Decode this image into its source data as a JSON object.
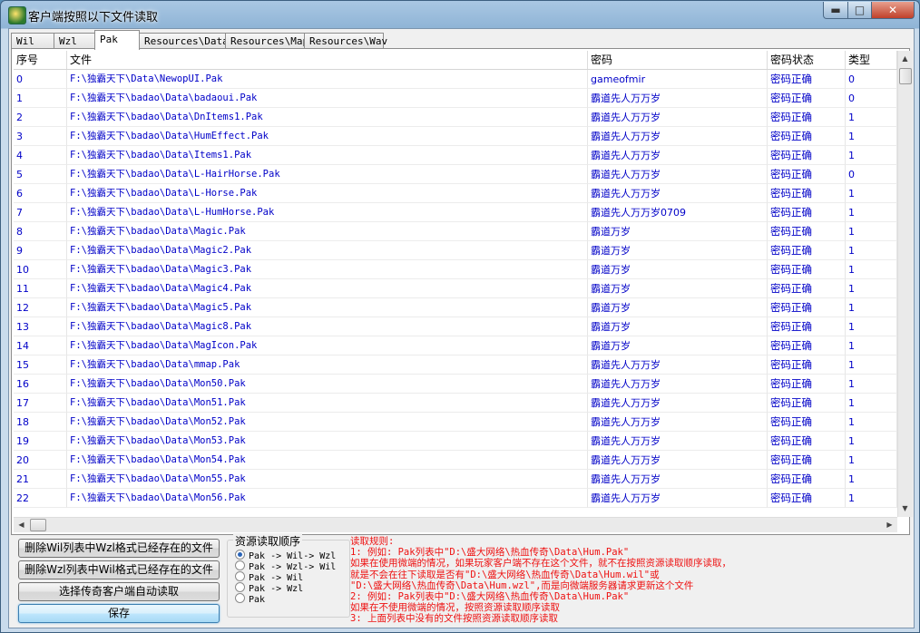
{
  "window": {
    "title": "客户端按照以下文件读取",
    "min_label": "▬",
    "max_label": "□",
    "close_label": "✕"
  },
  "tabs": [
    {
      "label": "Wil",
      "active": false
    },
    {
      "label": "Wzl",
      "active": false
    },
    {
      "label": "Pak",
      "active": true
    },
    {
      "label": "Resources\\Data",
      "active": false
    },
    {
      "label": "Resources\\Map",
      "active": false
    },
    {
      "label": "Resources\\Wav",
      "active": false
    }
  ],
  "table": {
    "columns": [
      "序号",
      "文件",
      "密码",
      "密码状态",
      "类型"
    ],
    "rows": [
      [
        "0",
        "F:\\独霸天下\\Data\\NewopUI.Pak",
        "gameofmir",
        "密码正确",
        "0"
      ],
      [
        "1",
        "F:\\独霸天下\\badao\\Data\\badaoui.Pak",
        "霸道先人万万岁",
        "密码正确",
        "0"
      ],
      [
        "2",
        "F:\\独霸天下\\badao\\Data\\DnItems1.Pak",
        "霸道先人万万岁",
        "密码正确",
        "1"
      ],
      [
        "3",
        "F:\\独霸天下\\badao\\Data\\HumEffect.Pak",
        "霸道先人万万岁",
        "密码正确",
        "1"
      ],
      [
        "4",
        "F:\\独霸天下\\badao\\Data\\Items1.Pak",
        "霸道先人万万岁",
        "密码正确",
        "1"
      ],
      [
        "5",
        "F:\\独霸天下\\badao\\Data\\L-HairHorse.Pak",
        "霸道先人万万岁",
        "密码正确",
        "0"
      ],
      [
        "6",
        "F:\\独霸天下\\badao\\Data\\L-Horse.Pak",
        "霸道先人万万岁",
        "密码正确",
        "1"
      ],
      [
        "7",
        "F:\\独霸天下\\badao\\Data\\L-HumHorse.Pak",
        "霸道先人万万岁0709",
        "密码正确",
        "1"
      ],
      [
        "8",
        "F:\\独霸天下\\badao\\Data\\Magic.Pak",
        "霸道万岁",
        "密码正确",
        "1"
      ],
      [
        "9",
        "F:\\独霸天下\\badao\\Data\\Magic2.Pak",
        "霸道万岁",
        "密码正确",
        "1"
      ],
      [
        "10",
        "F:\\独霸天下\\badao\\Data\\Magic3.Pak",
        "霸道万岁",
        "密码正确",
        "1"
      ],
      [
        "11",
        "F:\\独霸天下\\badao\\Data\\Magic4.Pak",
        "霸道万岁",
        "密码正确",
        "1"
      ],
      [
        "12",
        "F:\\独霸天下\\badao\\Data\\Magic5.Pak",
        "霸道万岁",
        "密码正确",
        "1"
      ],
      [
        "13",
        "F:\\独霸天下\\badao\\Data\\Magic8.Pak",
        "霸道万岁",
        "密码正确",
        "1"
      ],
      [
        "14",
        "F:\\独霸天下\\badao\\Data\\MagIcon.Pak",
        "霸道万岁",
        "密码正确",
        "1"
      ],
      [
        "15",
        "F:\\独霸天下\\badao\\Data\\mmap.Pak",
        "霸道先人万万岁",
        "密码正确",
        "1"
      ],
      [
        "16",
        "F:\\独霸天下\\badao\\Data\\Mon50.Pak",
        "霸道先人万万岁",
        "密码正确",
        "1"
      ],
      [
        "17",
        "F:\\独霸天下\\badao\\Data\\Mon51.Pak",
        "霸道先人万万岁",
        "密码正确",
        "1"
      ],
      [
        "18",
        "F:\\独霸天下\\badao\\Data\\Mon52.Pak",
        "霸道先人万万岁",
        "密码正确",
        "1"
      ],
      [
        "19",
        "F:\\独霸天下\\badao\\Data\\Mon53.Pak",
        "霸道先人万万岁",
        "密码正确",
        "1"
      ],
      [
        "20",
        "F:\\独霸天下\\badao\\Data\\Mon54.Pak",
        "霸道先人万万岁",
        "密码正确",
        "1"
      ],
      [
        "21",
        "F:\\独霸天下\\badao\\Data\\Mon55.Pak",
        "霸道先人万万岁",
        "密码正确",
        "1"
      ],
      [
        "22",
        "F:\\独霸天下\\badao\\Data\\Mon56.Pak",
        "霸道先人万万岁",
        "密码正确",
        "1"
      ]
    ]
  },
  "buttons": {
    "delete_wil": "删除Wil列表中Wzl格式已经存在的文件",
    "delete_wzl": "删除Wzl列表中Wil格式已经存在的文件",
    "select_client": "选择传奇客户端自动读取",
    "save": "保存"
  },
  "resource_order": {
    "title": "资源读取顺序",
    "options": [
      {
        "label": "Pak -> Wil-> Wzl",
        "selected": true
      },
      {
        "label": "Pak -> Wzl-> Wil",
        "selected": false
      },
      {
        "label": "Pak -> Wil",
        "selected": false
      },
      {
        "label": "Pak -> Wzl",
        "selected": false
      },
      {
        "label": "Pak",
        "selected": false
      }
    ]
  },
  "rules": [
    "读取规则:",
    "1: 例如: Pak列表中\"D:\\盛大网络\\热血传奇\\Data\\Hum.Pak\"",
    "    如果在使用微端的情况，如果玩家客户端不存在这个文件，就不在按照资源读取顺序读取，",
    "    就是不会在往下读取是否有\"D:\\盛大网络\\热血传奇\\Data\\Hum.wil\"或",
    "   \"D:\\盛大网络\\热血传奇\\Data\\Hum.wzl\",而是向微端服务器请求更新这个文件",
    "2: 例如: Pak列表中\"D:\\盛大网络\\热血传奇\\Data\\Hum.Pak\"",
    "    如果在不使用微端的情况，按照资源读取顺序读取",
    "3: 上面列表中没有的文件按照资源读取顺序读取"
  ],
  "colors": {
    "cell_text": "#0000c8",
    "rules_text": "#ee1111"
  }
}
